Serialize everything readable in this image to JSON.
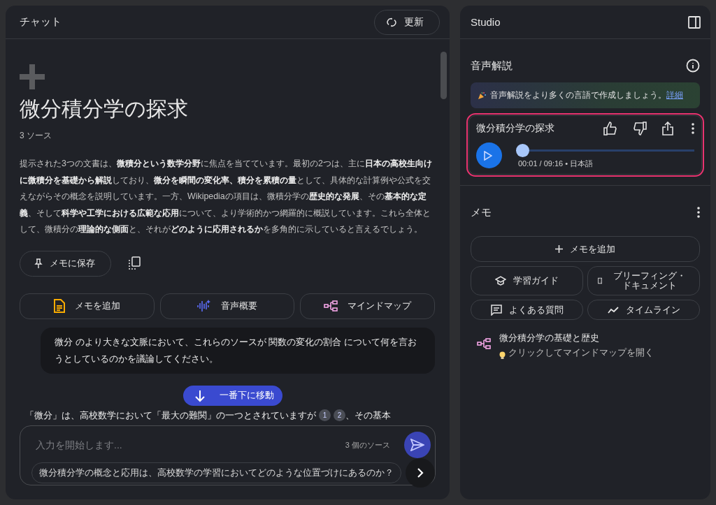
{
  "chat": {
    "title": "チャット",
    "refresh_button": "更新",
    "notebook_title": "微分積分学の探求",
    "source_count": "3 ソース",
    "summary": "提示された3つの文書は、**微積分という数学分野**に焦点を当てています。最初の2つは、主に**日本の高校生向けに微積分を基礎から解説**しており、**微分を瞬間の変化率、積分を累積の量**として、具体的な計算例や公式を交えながらその概念を説明しています。一方、Wikipediaの項目は、微積分学の**歴史的な発展**、その**基本的な定義**、そして**科学や工学における広範な応用**について、より学術的かつ網羅的に概説しています。これら全体として、微積分の**理論的な側面**と、それが**どのように応用されるか**を多角的に示していると言えるでしょう。",
    "save_button": "メモに保存",
    "actions": [
      {
        "label": "メモを追加",
        "kind": "note"
      },
      {
        "label": "音声概要",
        "kind": "audio"
      },
      {
        "label": "マインドマップ",
        "kind": "mindmap"
      }
    ],
    "user_message": "微分 のより大きな文脈において、これらのソースが 関数の変化の割合 について何を言おうとしているのかを議論してください。",
    "scroll_button": "一番下に移動",
    "response_start": "「微分」は、高校数学において「最大の難関」の一つとされていますが",
    "citations": [
      "1",
      "2"
    ],
    "response_end": "、その基本",
    "input": {
      "placeholder": "入力を開始します...",
      "source_count": "3 個のソース"
    },
    "suggestion": "微分積分学の概念と応用は、高校数学の学習においてどのような位置づけにあるのか？"
  },
  "studio": {
    "title": "Studio",
    "audio": {
      "title": "音声解説",
      "banner": "音声解説をより多くの言語で作成しましょう。",
      "banner_link": "詳細",
      "player": {
        "title": "微分積分学の探求",
        "level": 0.002,
        "time": "00:01 / 09:16 • 日本語",
        "highlighted": true
      }
    },
    "notes": {
      "title": "メモ",
      "add_button": "メモを追加",
      "tools": [
        {
          "label": "学習ガイド",
          "kind": "cap"
        },
        {
          "label": "ブリーフィング・ドキュメント",
          "kind": "doc"
        },
        {
          "label": "よくある質問",
          "kind": "faq"
        },
        {
          "label": "タイムライン",
          "kind": "trend"
        }
      ],
      "items": [
        {
          "title": "微分積分学の基礎と歴史",
          "hint": "クリックしてマインドマップを開く"
        }
      ]
    }
  }
}
